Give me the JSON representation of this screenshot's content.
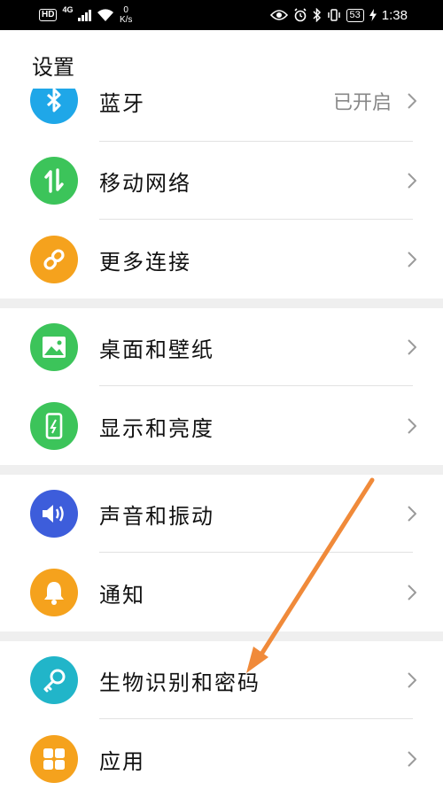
{
  "status_bar": {
    "hd": "HD",
    "network": "4G",
    "speed_value": "0",
    "speed_unit": "K/s",
    "battery": "53",
    "time": "1:38"
  },
  "page": {
    "title": "设置"
  },
  "rows": [
    {
      "label": "蓝牙",
      "value": "已开启",
      "icon": "bluetooth-icon",
      "color": "#1fa7e8"
    },
    {
      "label": "移动网络",
      "icon": "mobile-network-icon",
      "color": "#3cc45a"
    },
    {
      "label": "更多连接",
      "icon": "link-icon",
      "color": "#f5a21d"
    },
    {
      "label": "桌面和壁纸",
      "icon": "wallpaper-icon",
      "color": "#3cc45a"
    },
    {
      "label": "显示和亮度",
      "icon": "display-icon",
      "color": "#3cc45a"
    },
    {
      "label": "声音和振动",
      "icon": "speaker-icon",
      "color": "#3d5ddb"
    },
    {
      "label": "通知",
      "icon": "bell-icon",
      "color": "#f5a21d"
    },
    {
      "label": "生物识别和密码",
      "icon": "key-icon",
      "color": "#21b5c9"
    },
    {
      "label": "应用",
      "icon": "apps-grid-icon",
      "color": "#f5a21d"
    }
  ],
  "annotation": {
    "color": "#f08a3a"
  }
}
